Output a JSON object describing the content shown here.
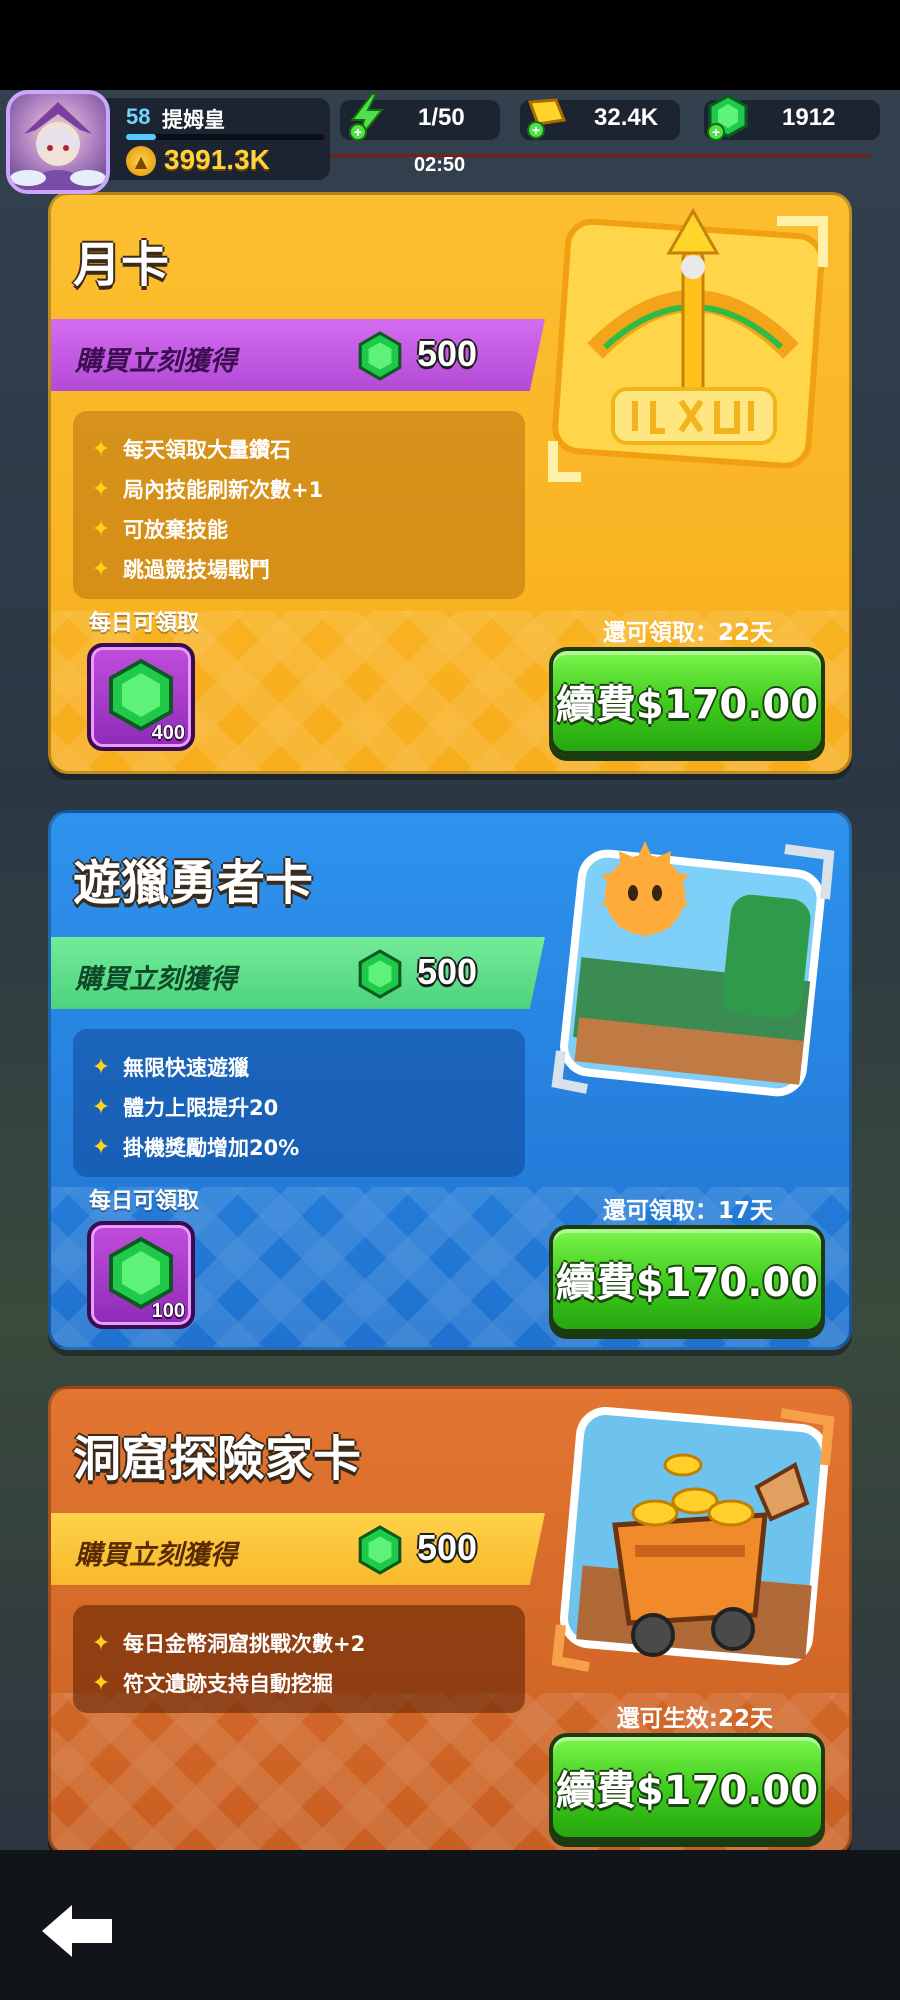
{
  "hud": {
    "player_level": "58",
    "player_name": "提姆皇",
    "power": "3991.3K",
    "stamina": "1/50",
    "stamina_timer": "02:50",
    "gold": "32.4K",
    "gems": "1912",
    "xp_progress": 0.15
  },
  "cards": [
    {
      "title": "月卡",
      "ribbon_label": "購買立刻獲得",
      "ribbon_amount": "500",
      "features": [
        "每天領取大量鑽石",
        "局內技能刷新次數+1",
        "可放棄技能",
        "跳過競技場戰鬥"
      ],
      "daily_label": "每日可領取",
      "daily_amount": "400",
      "remaining": "還可領取：22天",
      "button_label": "續費$170.00",
      "art_icon": "bow-and-arrow-card-art"
    },
    {
      "title": "遊獵勇者卡",
      "ribbon_label": "購買立刻獲得",
      "ribbon_amount": "500",
      "features": [
        "無限快速遊獵",
        "體力上限提升20",
        "掛機獎勵增加20%"
      ],
      "daily_label": "每日可領取",
      "daily_amount": "100",
      "remaining": "還可領取：17天",
      "button_label": "續費$170.00",
      "art_icon": "sun-landscape-card-art"
    },
    {
      "title": "洞窟探險家卡",
      "ribbon_label": "購買立刻獲得",
      "ribbon_amount": "500",
      "features": [
        "每日金幣洞窟挑戰次數+2",
        "符文遺跡支持自動挖掘"
      ],
      "remaining": "還可生效:22天",
      "button_label": "續費$170.00",
      "art_icon": "mine-cart-card-art"
    }
  ],
  "colors": {
    "card1_bg": "#fbb927",
    "card2_bg": "#2b86e0",
    "card3_bg": "#d8692a",
    "ribbon1": "#c25be3",
    "ribbon2": "#5fe08a",
    "ribbon3": "#ffc83a",
    "buy_green": "#3cc91c",
    "gem_green": "#1fc94a"
  },
  "nav": {
    "back_icon": "back-arrow-icon"
  }
}
